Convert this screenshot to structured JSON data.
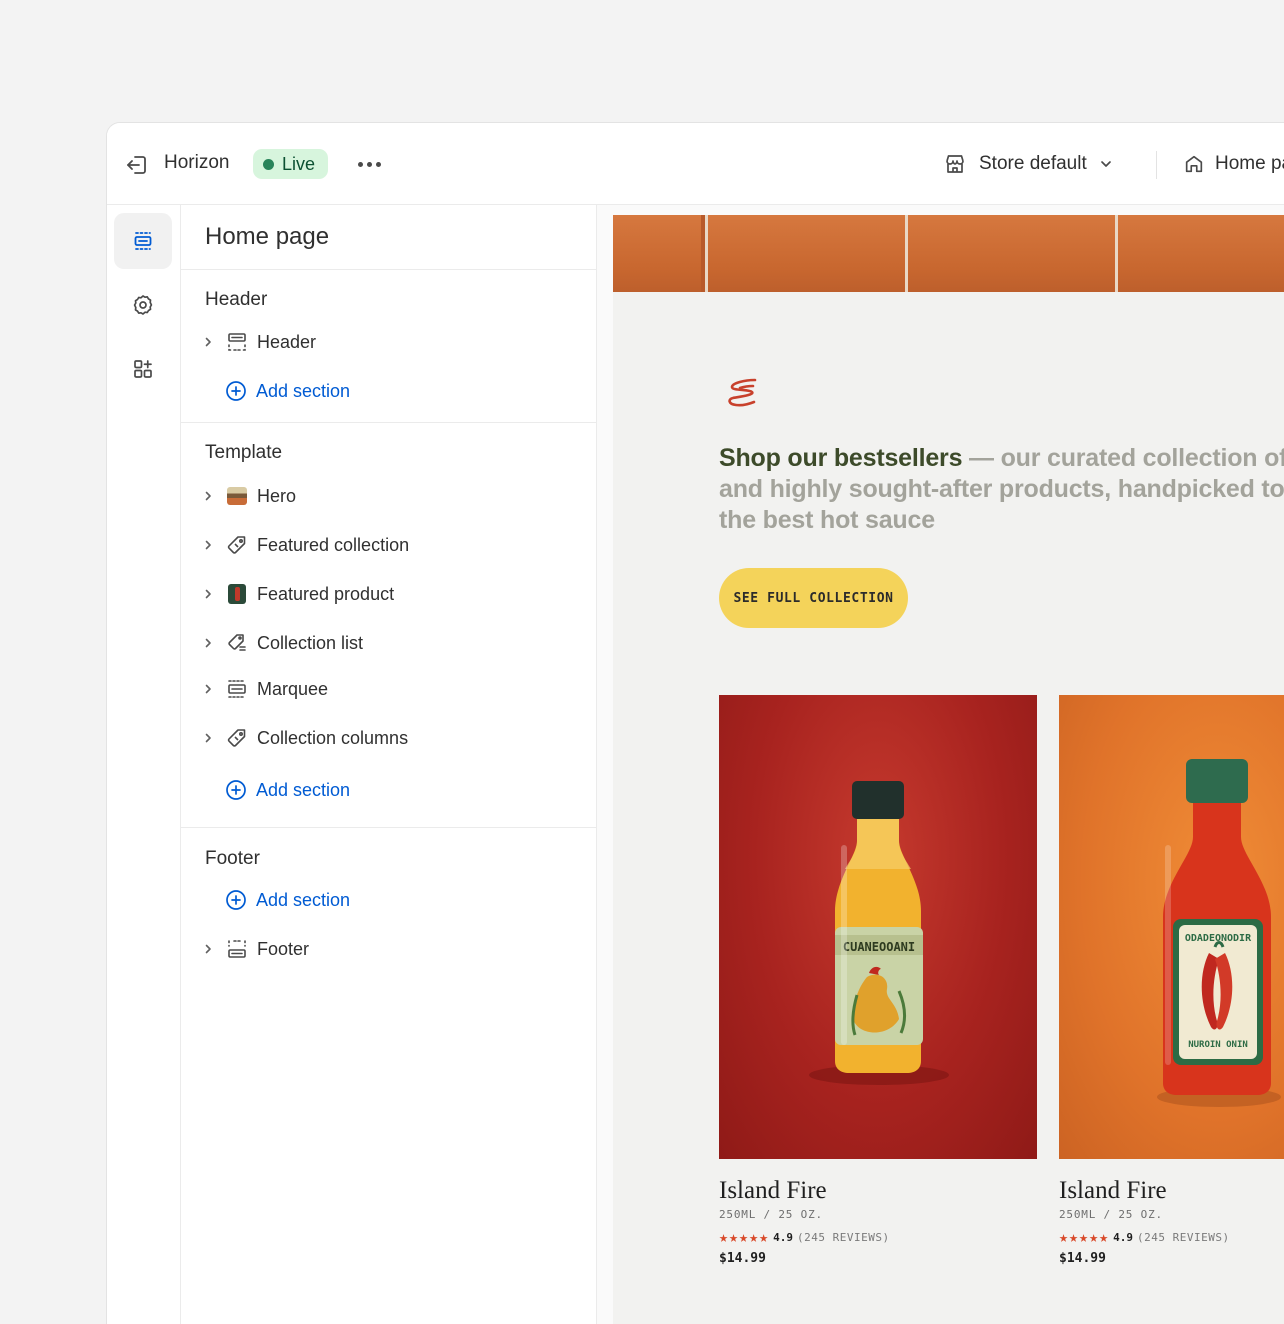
{
  "topbar": {
    "theme_name": "Horizon",
    "status_badge": "Live",
    "store_selector": "Store default",
    "page_selector": "Home page"
  },
  "rail": {
    "items": [
      {
        "icon": "sections-icon",
        "active": true
      },
      {
        "icon": "gear-icon",
        "active": false
      },
      {
        "icon": "apps-icon",
        "active": false
      }
    ]
  },
  "panel": {
    "title": "Home page",
    "header_group": {
      "title": "Header",
      "items": [
        {
          "label": "Header",
          "icon": "header-section-icon"
        }
      ],
      "add_label": "Add section"
    },
    "template_group": {
      "title": "Template",
      "items": [
        {
          "label": "Hero",
          "icon": "hero-thumbnail"
        },
        {
          "label": "Featured collection",
          "icon": "tag-icon"
        },
        {
          "label": "Featured product",
          "icon": "product-thumbnail"
        },
        {
          "label": "Collection list",
          "icon": "collection-list-icon"
        },
        {
          "label": "Marquee",
          "icon": "marquee-icon"
        },
        {
          "label": "Collection columns",
          "icon": "tag-icon"
        }
      ],
      "add_label": "Add section"
    },
    "footer_group": {
      "title": "Footer",
      "add_label": "Add section",
      "items": [
        {
          "label": "Footer",
          "icon": "footer-section-icon"
        }
      ]
    }
  },
  "preview": {
    "headline_highlight": "Shop our bestsellers",
    "headline_rest": " — our curated collection of top-rated and highly sought-after products, handpicked to bring you the best hot sauce",
    "cta_label": "SEE FULL COLLECTION",
    "products": [
      {
        "name": "Island Fire",
        "size": "250ML / 25 OZ.",
        "stars": "★★★★★",
        "score": "4.9",
        "reviews": "(245 REVIEWS)",
        "price": "$14.99"
      },
      {
        "name": "Island Fire",
        "size": "250ML / 25 OZ.",
        "stars": "★★★★★",
        "score": "4.9",
        "reviews": "(245 REVIEWS)",
        "price": "$14.99"
      }
    ]
  },
  "colors": {
    "accent_link": "#005bd3",
    "live_badge_bg": "#d7f5dd",
    "live_dot": "#29845a",
    "cta_bg": "#f4d35a",
    "headline_highlight": "#3d4b2a",
    "star": "#d94a2a"
  }
}
